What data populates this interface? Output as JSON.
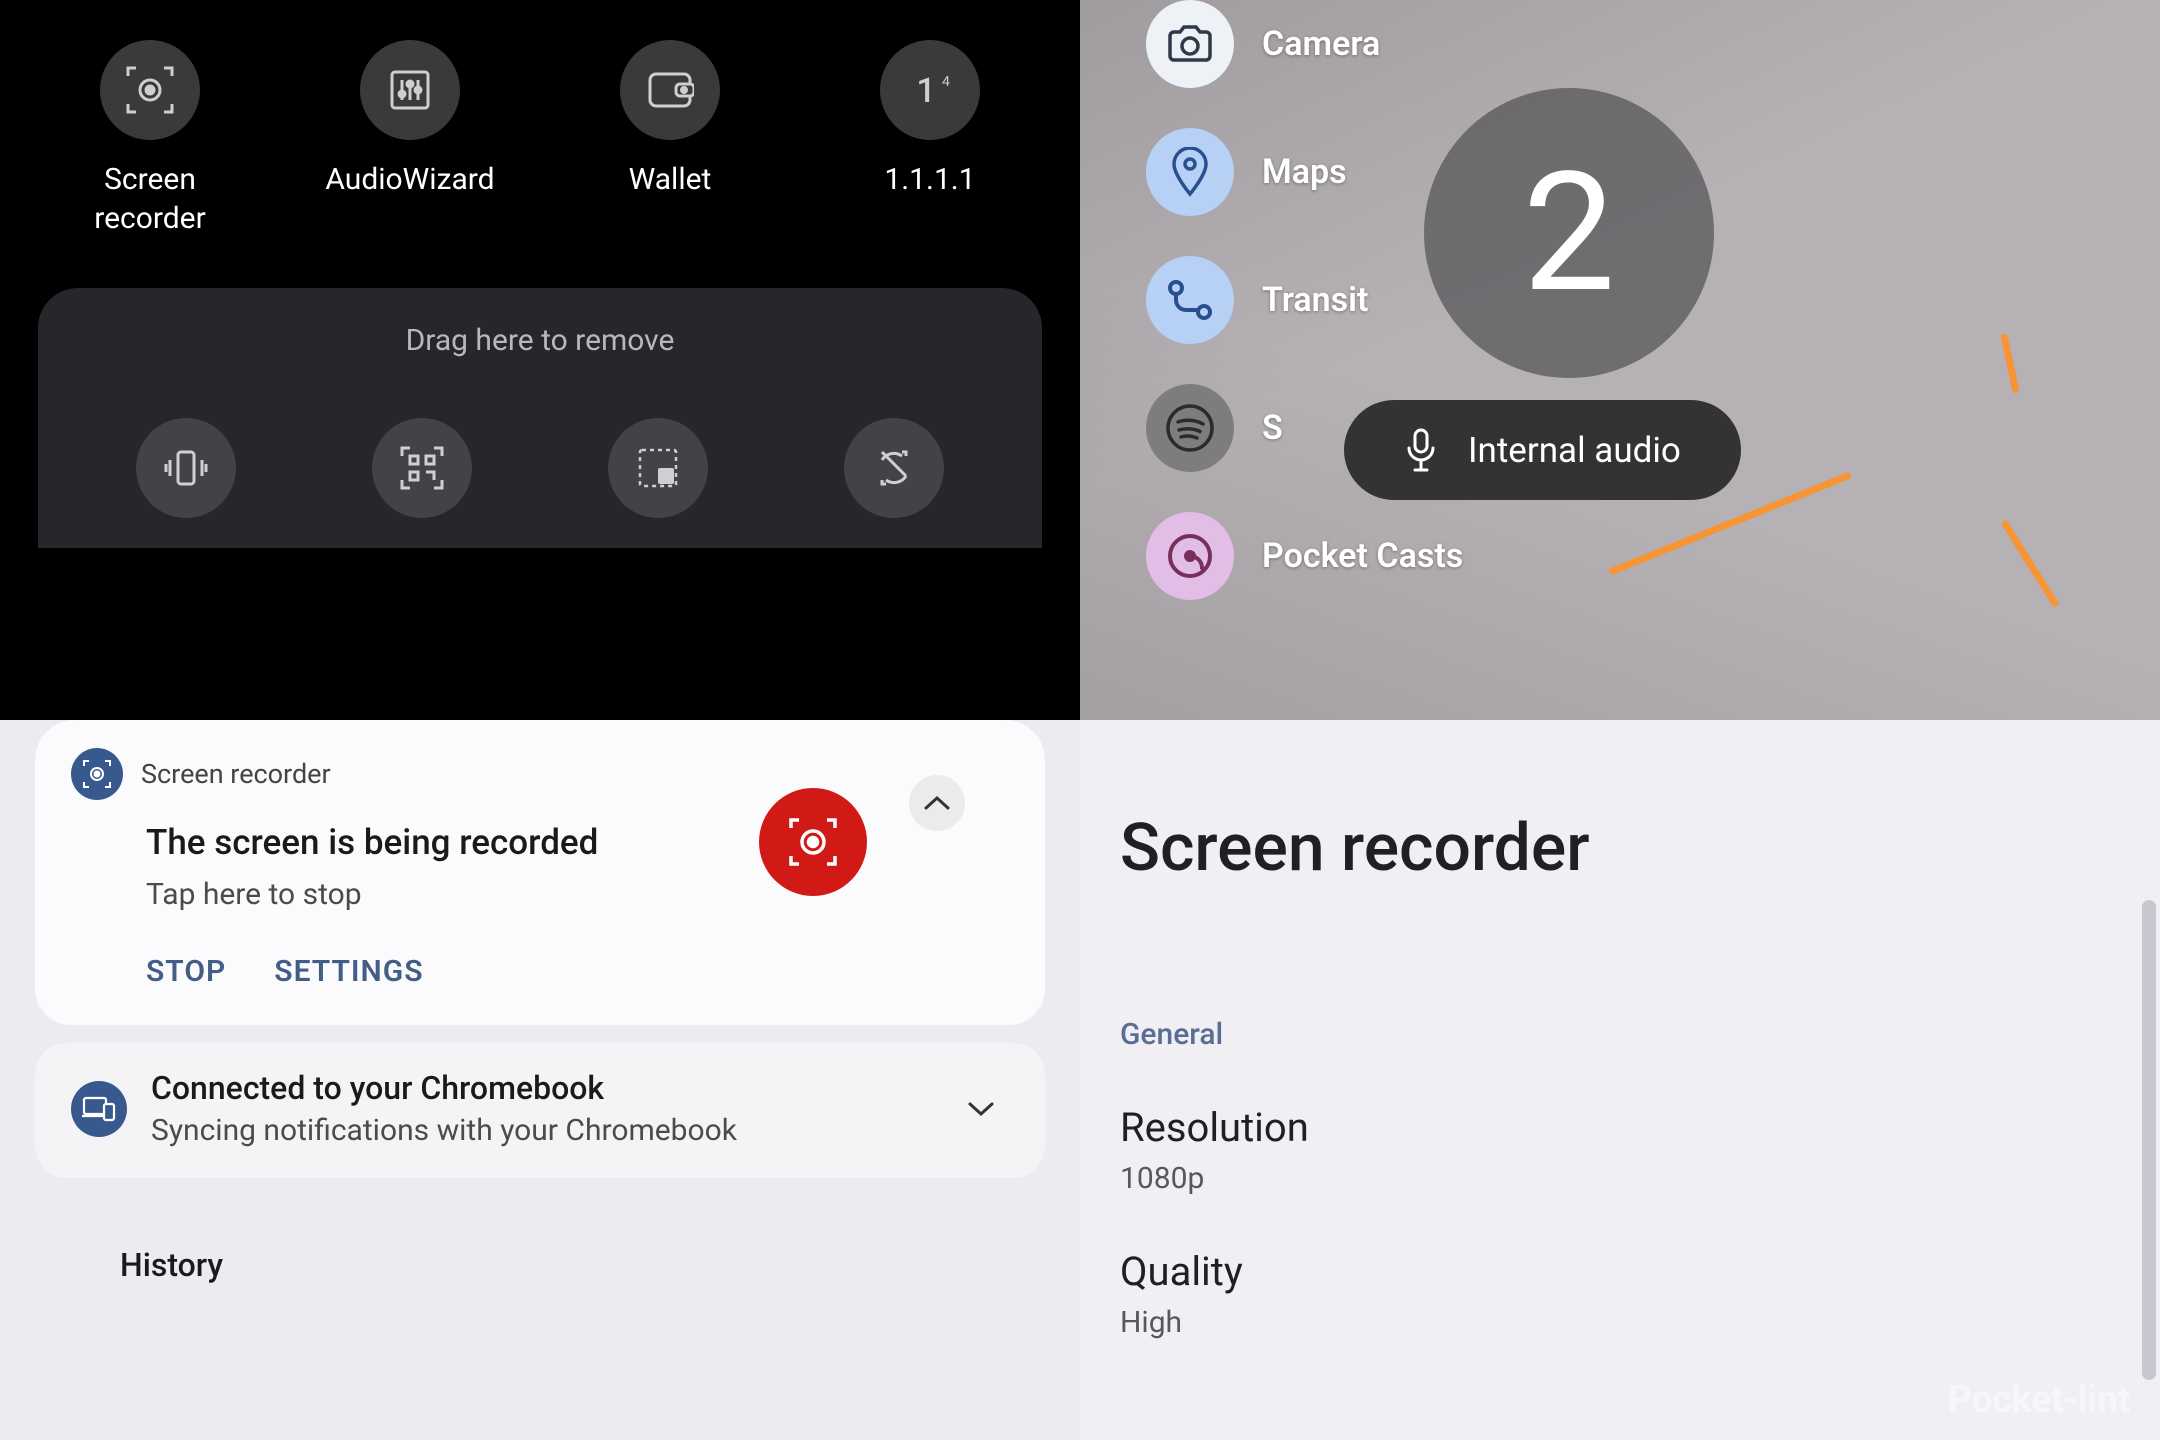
{
  "q1": {
    "tiles": [
      {
        "name": "screen-recorder",
        "label": "Screen recorder",
        "icon": "record-frame"
      },
      {
        "name": "audiowizard",
        "label": "AudioWizard",
        "icon": "equalizer"
      },
      {
        "name": "wallet",
        "label": "Wallet",
        "icon": "wallet"
      },
      {
        "name": "one-one-one-one",
        "label": "1.1.1.1",
        "icon": "one-four"
      }
    ],
    "drop_label": "Drag here to remove",
    "drop_tiles": [
      {
        "name": "vibrate",
        "icon": "vibrate"
      },
      {
        "name": "qr-code",
        "icon": "qr"
      },
      {
        "name": "select-area",
        "icon": "select"
      },
      {
        "name": "rotate-toggle",
        "icon": "rotate"
      }
    ]
  },
  "q2": {
    "apps": [
      {
        "name": "camera",
        "label": "Camera",
        "bg": "#eef1f6",
        "fg": "#2e3a4a",
        "icon": "camera"
      },
      {
        "name": "maps",
        "label": "Maps",
        "bg": "#b7d1f6",
        "fg": "#2a4f8f",
        "icon": "pin"
      },
      {
        "name": "transit",
        "label": "Transit",
        "bg": "#b7d1f6",
        "fg": "#2a4f8f",
        "icon": "route"
      },
      {
        "name": "spotify",
        "label": "S",
        "bg": "#7d7d80",
        "fg": "#efefef",
        "icon": "spotify"
      },
      {
        "name": "pocket-casts",
        "label": "Pocket Casts",
        "bg": "#e2bee6",
        "fg": "#7a2e5c",
        "icon": "podcast"
      }
    ],
    "countdown": "2",
    "pill_label": "Internal audio"
  },
  "q3": {
    "n1": {
      "app": "Screen recorder",
      "title": "The screen is being recorded",
      "subtitle": "Tap here to stop",
      "actions": {
        "stop": "STOP",
        "settings": "SETTINGS"
      }
    },
    "n2": {
      "title": "Connected to your Chromebook",
      "subtitle": "Syncing notifications with your Chromebook"
    },
    "history": "History"
  },
  "q4": {
    "title": "Screen recorder",
    "section": "General",
    "items": [
      {
        "name": "resolution",
        "label": "Resolution",
        "value": "1080p"
      },
      {
        "name": "quality",
        "label": "Quality",
        "value": "High"
      }
    ]
  },
  "watermark": "Pocket-lint"
}
